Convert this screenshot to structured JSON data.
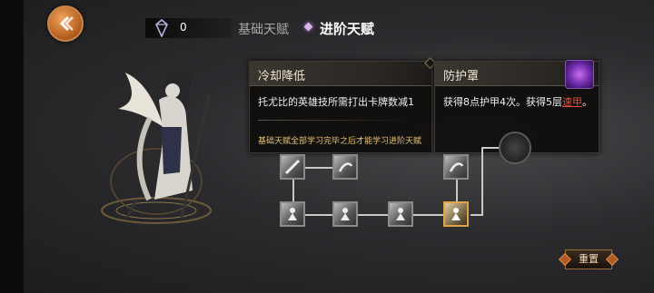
{
  "top_bar": {
    "currency_icon": "rune-crystal-icon",
    "currency_value": "0",
    "tab_basic": "基础天赋",
    "tab_advanced": "进阶天赋"
  },
  "panels": {
    "left": {
      "title": "冷却降低",
      "description": "托尤比的英雄技所需打出卡牌数减1",
      "note": "基础天赋全部学习完毕之后才能学习进阶天赋"
    },
    "right": {
      "title": "防护罩",
      "description_prefix": "获得8点护甲4次。获得5层",
      "description_link": "速甲",
      "description_suffix": "。"
    }
  },
  "reset_label": "重置",
  "colors": {
    "accent": "#e0a24a",
    "link": "#e54a3c",
    "note": "#e2c37a"
  }
}
